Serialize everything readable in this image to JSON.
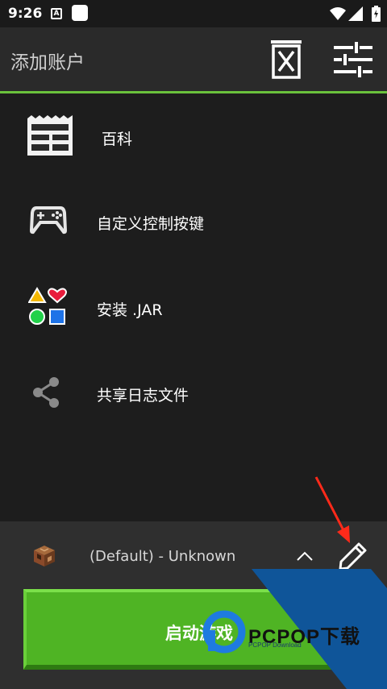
{
  "status_bar": {
    "time": "9:26",
    "notification_icon": "a-box-icon"
  },
  "toolbar": {
    "title": "添加账户",
    "delete_icon": "delete-profile-icon",
    "settings_icon": "tune-sliders-icon"
  },
  "menu": {
    "items": [
      {
        "label": "百科",
        "icon": "wiki-icon"
      },
      {
        "label": "自定义控制按键",
        "icon": "gamepad-icon"
      },
      {
        "label": "安装 .JAR",
        "icon": "shapes-icon"
      },
      {
        "label": "共享日志文件",
        "icon": "share-icon"
      }
    ]
  },
  "profile": {
    "name": "(Default) - Unknown",
    "icon": "crafting-table-icon"
  },
  "play_button": {
    "label": "启动游戏"
  },
  "watermark": {
    "brand": "PCPOP下载",
    "sub": "PCPOP Download"
  },
  "colors": {
    "accent": "#6ac23c",
    "play": "#4fb424",
    "background": "#1d1d1d",
    "toolbar": "#2a2a2a",
    "annotation_arrow": "#ff2a1a"
  }
}
